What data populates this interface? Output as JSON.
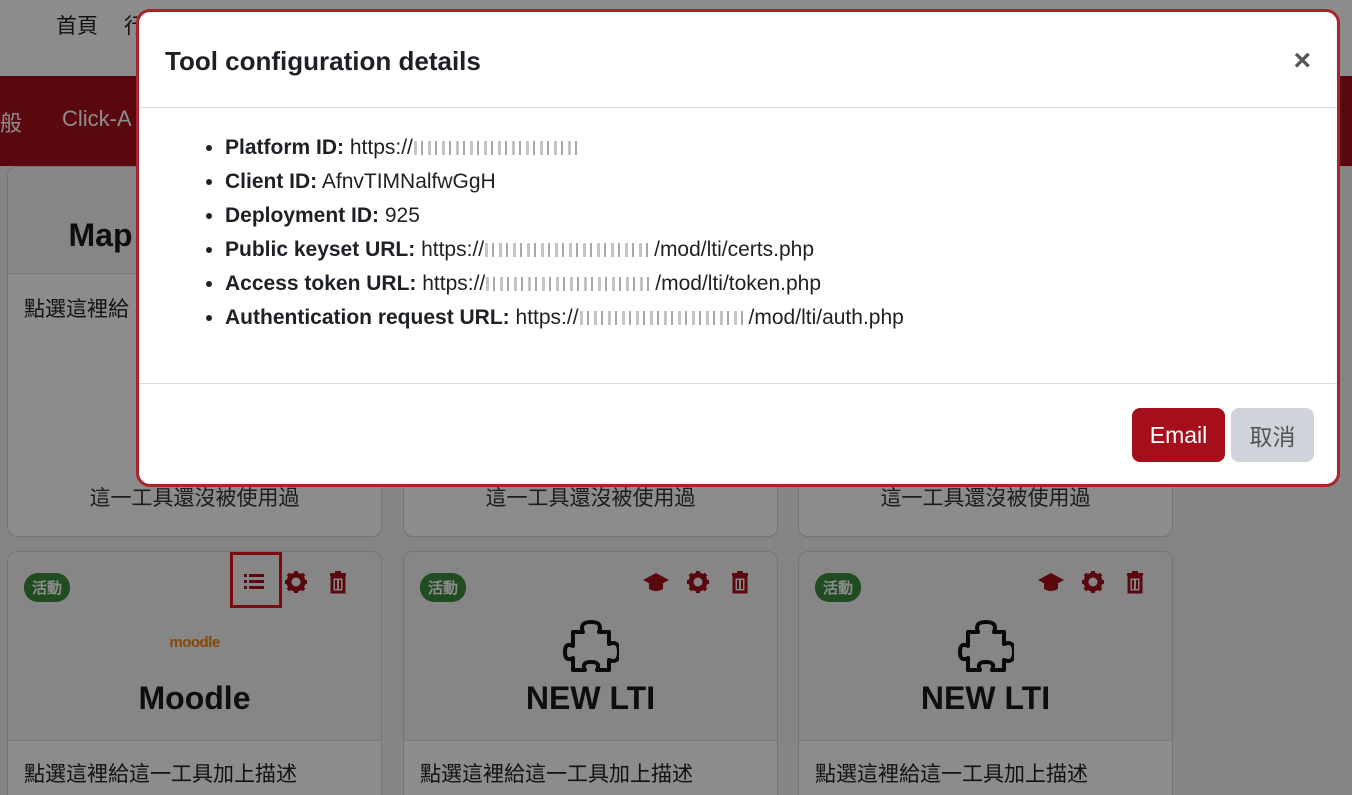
{
  "topnav": {
    "items": [
      "首頁",
      "行"
    ]
  },
  "redbar": {
    "items": [
      "般",
      "Click-A"
    ]
  },
  "cards_top": [
    {
      "name": "Map",
      "desc": "點選這裡給",
      "note": "這一工具還沒被使用過"
    },
    {
      "note": "這一工具還沒被使用過"
    },
    {
      "note": "這一工具還沒被使用過"
    }
  ],
  "cards_bottom": [
    {
      "badge": "活動",
      "logo": "moodle",
      "name": "Moodle",
      "desc": "點選這裡給這一工具加上描述"
    },
    {
      "badge": "活動",
      "name": "NEW LTI",
      "desc": "點選這裡給這一工具加上描述"
    },
    {
      "badge": "活動",
      "name": "NEW LTI",
      "desc": "點選這裡給這一工具加上描述"
    }
  ],
  "modal": {
    "title": "Tool configuration details",
    "close": "×",
    "rows": [
      {
        "label": "Platform ID:",
        "prefix": "https://",
        "suffix": ""
      },
      {
        "label": "Client ID:",
        "value": "AfnvTIMNalfwGgH"
      },
      {
        "label": "Deployment ID:",
        "value": "925"
      },
      {
        "label": "Public keyset URL:",
        "prefix": "https://",
        "suffix": "/mod/lti/certs.php"
      },
      {
        "label": "Access token URL:",
        "prefix": "https://",
        "suffix": "/mod/lti/token.php"
      },
      {
        "label": "Authentication request URL:",
        "prefix": "https://",
        "suffix": "/mod/lti/auth.php"
      }
    ],
    "email_label": "Email",
    "cancel_label": "取消"
  },
  "colors": {
    "brand": "#a50f1b",
    "badge": "#3c8a3c",
    "highlight": "#e0141e"
  }
}
